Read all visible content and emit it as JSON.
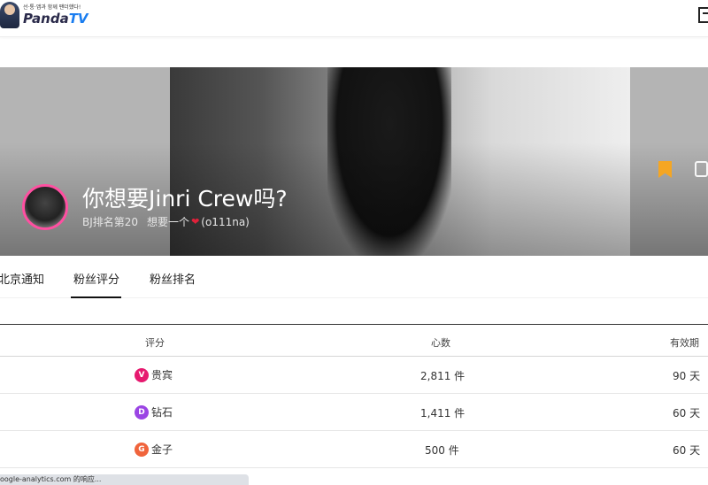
{
  "header": {
    "logo_slogan": "선·통·앱과 함께 팬더했다!",
    "logo_brand_panda": "Panda",
    "logo_brand_tv": "TV"
  },
  "banner": {
    "title": "你想要Jinri Crew吗?",
    "rank_text": "BJ排名第20",
    "nickname_prefix": "想要一个",
    "heart_glyph": "❤",
    "user_id": "(o111na)"
  },
  "tabs": [
    {
      "label": "北京通知",
      "active": false
    },
    {
      "label": "粉丝评分",
      "active": true
    },
    {
      "label": "粉丝排名",
      "active": false
    }
  ],
  "table": {
    "headers": {
      "grade": "评分",
      "hearts": "心数",
      "validity": "有效期"
    },
    "rows": [
      {
        "badge": "V",
        "badge_color": "#e6196f",
        "grade": "贵宾",
        "hearts": "2,811 件",
        "validity": "90 天"
      },
      {
        "badge": "D",
        "badge_color": "#9b45e4",
        "grade": "钻石",
        "hearts": "1,411 件",
        "validity": "60 天"
      },
      {
        "badge": "G",
        "badge_color": "#f0643c",
        "grade": "金子",
        "hearts": "500 件",
        "validity": "60 天"
      }
    ]
  },
  "statusbar": {
    "text": "oogle-analytics.com 的响应..."
  }
}
